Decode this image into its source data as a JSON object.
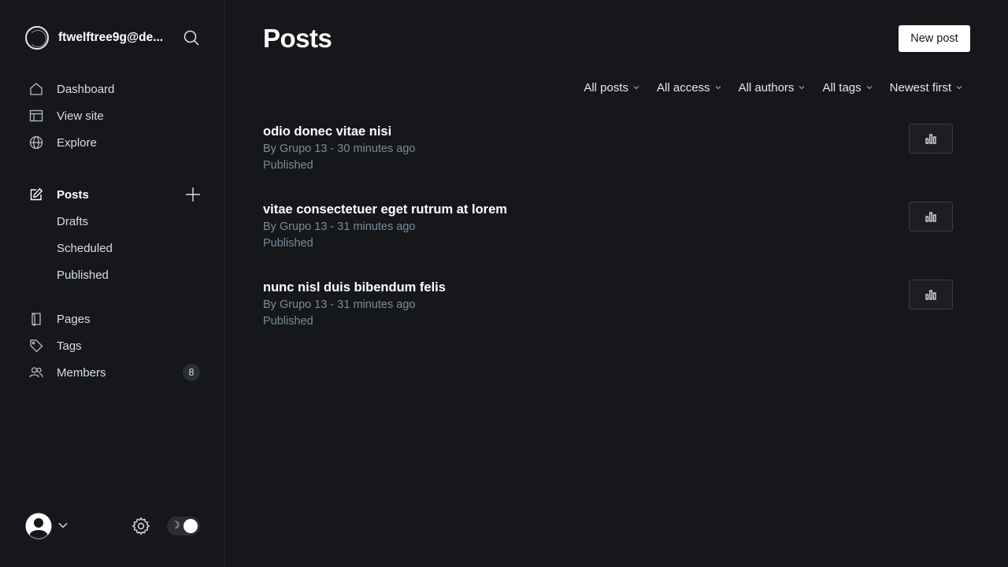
{
  "site": {
    "title": "ftwelftree9g@de...",
    "logo_icon": "circle-logo-icon",
    "search_icon": "search-icon"
  },
  "sidebar": {
    "nav": [
      {
        "label": "Dashboard",
        "icon": "home-icon"
      },
      {
        "label": "View site",
        "icon": "layout-icon"
      },
      {
        "label": "Explore",
        "icon": "globe-icon"
      }
    ],
    "posts": {
      "label": "Posts",
      "icon": "edit-icon",
      "add_icon": "plus-icon",
      "sub_items": [
        "Drafts",
        "Scheduled",
        "Published"
      ]
    },
    "secondary": [
      {
        "label": "Pages",
        "icon": "page-icon"
      },
      {
        "label": "Tags",
        "icon": "tag-icon"
      },
      {
        "label": "Members",
        "icon": "members-icon",
        "count": "8"
      }
    ],
    "footer": {
      "avatar_icon": "user-avatar-icon",
      "chevron_icon": "chevron-down-icon",
      "settings_icon": "gear-icon",
      "theme_toggle_icon": "moon-icon"
    }
  },
  "main": {
    "title": "Posts",
    "new_post_label": "New post",
    "filters": [
      "All posts",
      "All access",
      "All authors",
      "All tags",
      "Newest first"
    ],
    "posts": [
      {
        "title": "odio donec vitae nisi",
        "meta": "By Grupo 13 - 30 minutes ago",
        "status": "Published"
      },
      {
        "title": "vitae consectetuer eget rutrum at lorem",
        "meta": "By Grupo 13 - 31 minutes ago",
        "status": "Published"
      },
      {
        "title": "nunc nisl duis bibendum felis",
        "meta": "By Grupo 13 - 31 minutes ago",
        "status": "Published"
      }
    ],
    "analytics_icon": "bar-chart-icon"
  },
  "colors": {
    "background": "#15171a",
    "text": "#ffffff",
    "muted": "#7c8b9a",
    "button_bg": "#ffffff"
  }
}
